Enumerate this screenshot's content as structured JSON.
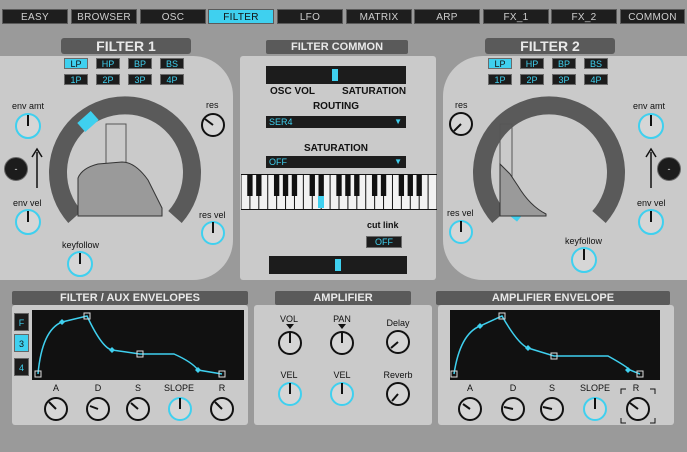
{
  "tabs": [
    {
      "label": "EASY",
      "active": false
    },
    {
      "label": "BROWSER",
      "active": false
    },
    {
      "label": "OSC",
      "active": false
    },
    {
      "label": "FILTER",
      "active": true
    },
    {
      "label": "LFO",
      "active": false
    },
    {
      "label": "MATRIX",
      "active": false
    },
    {
      "label": "ARP",
      "active": false
    },
    {
      "label": "FX_1",
      "active": false
    },
    {
      "label": "FX_2",
      "active": false
    },
    {
      "label": "COMMON",
      "active": false
    }
  ],
  "filter1": {
    "title": "FILTER 1",
    "types_row1": [
      "LP",
      "HP",
      "BP",
      "BS"
    ],
    "types_row2": [
      "1P",
      "2P",
      "3P",
      "4P"
    ],
    "active_type": "LP",
    "env_amt": "env amt",
    "env_vel": "env vel",
    "res": "res",
    "res_vel": "res vel",
    "keyfollow": "keyfollow",
    "side_button": "-"
  },
  "filter2": {
    "title": "FILTER 2",
    "types_row1": [
      "LP",
      "HP",
      "BP",
      "BS"
    ],
    "types_row2": [
      "1P",
      "2P",
      "3P",
      "4P"
    ],
    "active_type": "LP",
    "env_amt": "env amt",
    "env_vel": "env vel",
    "res": "res",
    "res_vel": "res vel",
    "keyfollow": "keyfollow",
    "side_button": "-"
  },
  "filter_common": {
    "title": "FILTER COMMON",
    "osc_vol": "OSC VOL",
    "saturation_label": "SATURATION",
    "balance_fraction": 0.49,
    "routing_label": "ROUTING",
    "routing_value": "SER4",
    "saturation_title": "SATURATION",
    "saturation_value": "OFF",
    "cut_link_label": "cut link",
    "cut_link_value": "OFF",
    "bottom_slider_fraction": 0.5
  },
  "filter_aux_env": {
    "title": "FILTER / AUX ENVELOPES",
    "side_buttons": [
      "F",
      "3",
      "4"
    ],
    "knobs": [
      "A",
      "D",
      "S",
      "SLOPE",
      "R"
    ]
  },
  "amplifier": {
    "title": "AMPLIFIER",
    "vol": "VOL",
    "pan": "PAN",
    "delay": "Delay",
    "vel1": "VEL",
    "vel2": "VEL",
    "reverb": "Reverb"
  },
  "amp_env": {
    "title": "AMPLIFIER ENVELOPE",
    "knobs": [
      "A",
      "D",
      "S",
      "SLOPE",
      "R"
    ]
  },
  "colors": {
    "accent": "#3fd0ef",
    "panel": "#cacaca",
    "header": "#5a5a5a",
    "dark": "#1c1c1c"
  }
}
